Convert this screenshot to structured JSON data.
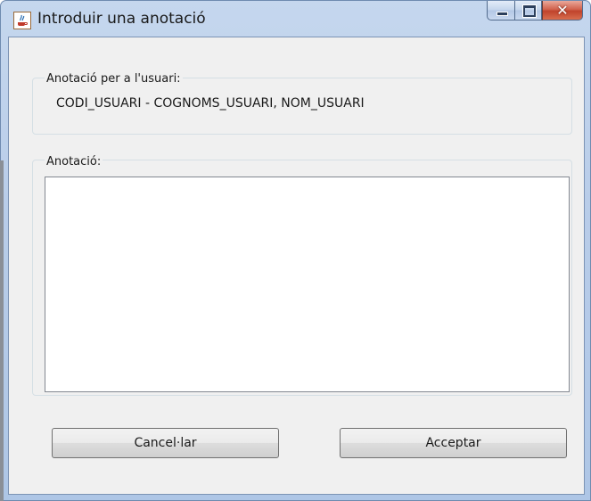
{
  "window": {
    "title": "Introduir una anotació",
    "icon": "java-coffee-icon",
    "controls": {
      "minimize": "minimize-icon",
      "maximize": "maximize-icon",
      "close": "close-icon"
    }
  },
  "user_group": {
    "title": "Anotació per a l'usuari:",
    "value": "CODI_USUARI - COGNOMS_USUARI, NOM_USUARI"
  },
  "note_group": {
    "title": "Anotació:",
    "text": ""
  },
  "buttons": {
    "cancel": "Cancel·lar",
    "accept": "Acceptar"
  },
  "colors": {
    "close_button": "#c0432c",
    "client_bg": "#f0f0f0",
    "frame": "#b9cde9"
  }
}
